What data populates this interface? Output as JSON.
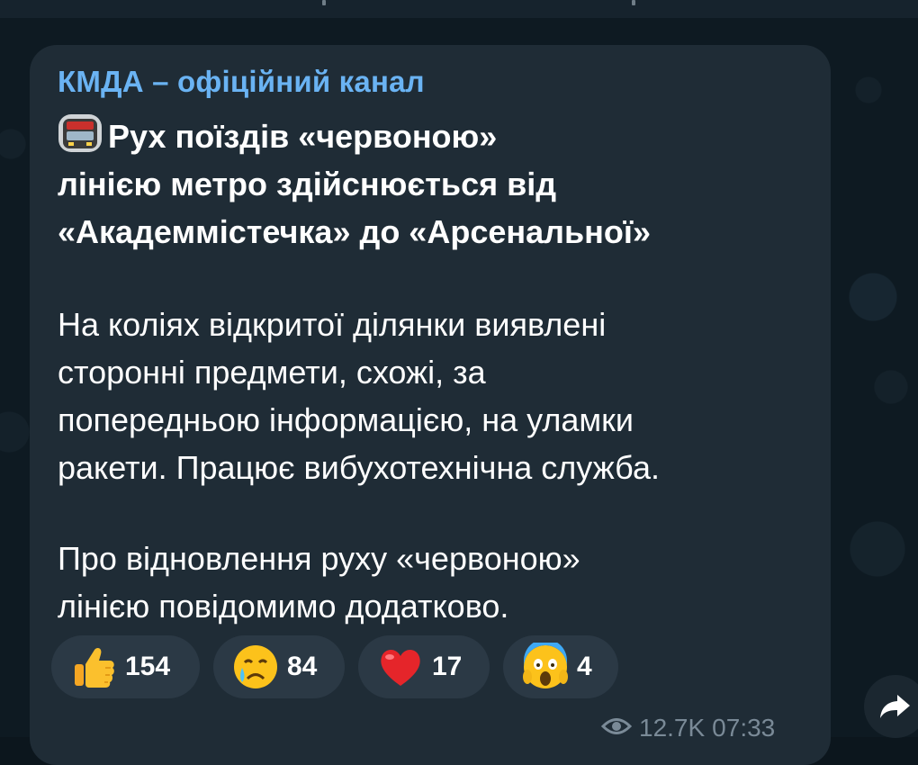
{
  "channel": {
    "name": "КМДА – офіційний канал"
  },
  "message": {
    "title_lines": [
      "Рух поїздів «червоною»",
      "лінією метро здійснюється від",
      "«Академмістечка» до «Арсенальної»"
    ],
    "body_lines": [
      "На коліях відкритої ділянки виявлені",
      "сторонні предмети, схожі, за",
      "попередньою інформацією, на уламки",
      "ракети. Працює вибухотехнічна служба."
    ],
    "footer_lines": [
      "Про відновлення руху «червоною»",
      "лінією повідомимо додатково."
    ]
  },
  "reactions": [
    {
      "icon": "thumbs-up-icon",
      "count": "154"
    },
    {
      "icon": "crying-face-icon",
      "count": "84"
    },
    {
      "icon": "red-heart-icon",
      "count": "17"
    },
    {
      "icon": "screaming-face-icon",
      "count": "4"
    }
  ],
  "meta": {
    "views": "12.7K",
    "time": "07:33"
  },
  "colors": {
    "background": "#0e1a22",
    "bubble": "#1f2c36",
    "channel_name": "#6ab3f3",
    "reaction_bg": "#2b3945",
    "meta_text": "#7a8a97"
  }
}
